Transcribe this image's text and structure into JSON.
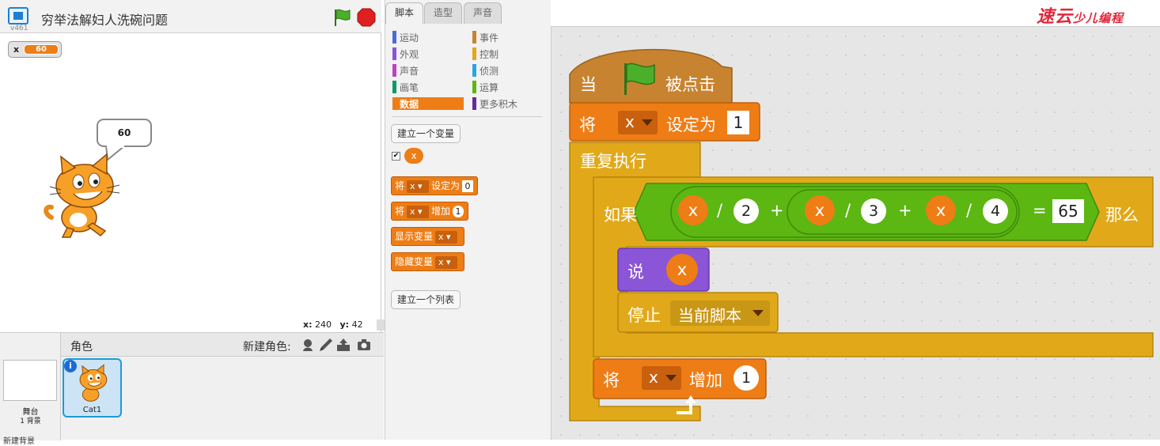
{
  "stage": {
    "title": "穷举法解妇人洗碗问题",
    "version": "v461",
    "monitor": {
      "name": "x",
      "value": "60"
    },
    "speech": "60",
    "coords": {
      "x_label": "x:",
      "x_value": "240",
      "y_label": "y:",
      "y_value": "42"
    }
  },
  "sprites": {
    "header_label": "角色",
    "new_sprite_label": "新建角色:",
    "stage_name": "舞台",
    "stage_backdrops": "1 背景",
    "new_backdrop": "新建背景",
    "items": [
      {
        "name": "Cat1"
      }
    ]
  },
  "palette": {
    "tabs": [
      "脚本",
      "造型",
      "声音"
    ],
    "active_tab": 0,
    "categories_left": [
      {
        "label": "运动",
        "color": "#4a6cd4"
      },
      {
        "label": "外观",
        "color": "#8a55d7"
      },
      {
        "label": "声音",
        "color": "#bb42c3"
      },
      {
        "label": "画笔",
        "color": "#0e9a6c"
      },
      {
        "label": "数据",
        "color": "#ee7d16"
      }
    ],
    "categories_right": [
      {
        "label": "事件",
        "color": "#c88330"
      },
      {
        "label": "控制",
        "color": "#e1a91a"
      },
      {
        "label": "侦测",
        "color": "#2ca5e2"
      },
      {
        "label": "运算",
        "color": "#5cb712"
      },
      {
        "label": "更多积木",
        "color": "#632d99"
      }
    ],
    "active_category": "数据",
    "make_variable": "建立一个变量",
    "make_list": "建立一个列表",
    "var_name": "x",
    "checkbox_mark": "✔",
    "blocks": [
      {
        "pre": "将",
        "dd": "x",
        "post": "设定为",
        "value": "0",
        "round": false
      },
      {
        "pre": "将",
        "dd": "x",
        "post": "增加",
        "value": "1",
        "round": true
      },
      {
        "pre": "显示变量",
        "dd": "x",
        "post": "",
        "value": "",
        "round": false
      },
      {
        "pre": "隐藏变量",
        "dd": "x",
        "post": "",
        "value": "",
        "round": false
      }
    ]
  },
  "script": {
    "hat": {
      "pre": "当",
      "post": "被点击"
    },
    "set": {
      "pre": "将",
      "var": "x",
      "post": "设定为",
      "value": "1"
    },
    "forever": {
      "label": "重复执行"
    },
    "if": {
      "pre": "如果",
      "post": "那么",
      "terms": [
        {
          "var": "x",
          "op": "/",
          "den": "2"
        },
        {
          "var": "x",
          "op": "/",
          "den": "3"
        },
        {
          "var": "x",
          "op": "/",
          "den": "4"
        }
      ],
      "plus": "+",
      "eq": "=",
      "target": "65"
    },
    "say": {
      "label": "说",
      "var": "x"
    },
    "stop": {
      "label": "停止",
      "option": "当前脚本"
    },
    "change": {
      "pre": "将",
      "var": "x",
      "post": "增加",
      "value": "1"
    }
  },
  "logo": {
    "big": "速云",
    "small": "少儿编程"
  },
  "colors": {
    "events": "#c88330",
    "data": "#ee7d16",
    "control": "#e1a91a",
    "operators": "#5cb712",
    "looks": "#8a55d7",
    "flag": "#2e8b1a",
    "stop": "#e02020"
  }
}
